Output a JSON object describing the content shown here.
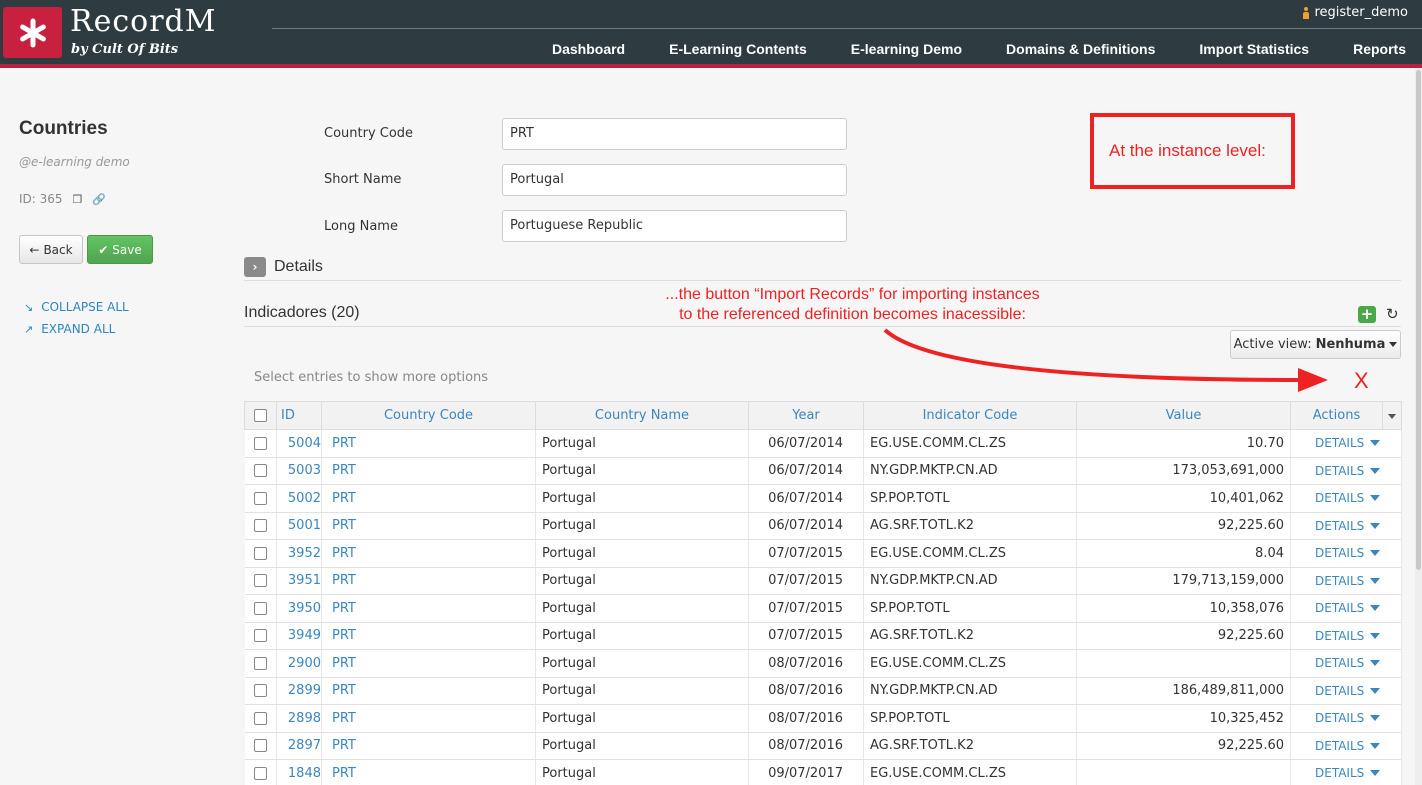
{
  "app": {
    "title": "RecordM",
    "subtitle": "by Cult Of Bits",
    "user": "register_demo"
  },
  "nav": [
    "Dashboard",
    "E-Learning Contents",
    "E-learning Demo",
    "Domains & Definitions",
    "Import Statistics",
    "Reports"
  ],
  "sidebar": {
    "title": "Countries",
    "subtitle": "@e-learning demo",
    "id_label": "ID: 365",
    "back_label": "Back",
    "save_label": "Save",
    "collapse_label": "COLLAPSE ALL",
    "expand_label": "EXPAND ALL"
  },
  "form": {
    "fields": [
      {
        "label": "Country Code",
        "value": "PRT"
      },
      {
        "label": "Short Name",
        "value": "Portugal"
      },
      {
        "label": "Long Name",
        "value": "Portuguese Republic"
      }
    ],
    "details_label": "Details"
  },
  "annotations": {
    "box_text": "At the instance level:",
    "message_line1": "...the button “Import Records” for importing instances",
    "message_line2": "to the referenced definition becomes inacessible:",
    "x_mark": "X"
  },
  "indicators": {
    "title": "Indicadores (20)",
    "active_view_label": "Active view:",
    "active_view_value": "Nenhuma",
    "select_hint": "Select entries to show more options",
    "columns": [
      "ID",
      "Country Code",
      "Country Name",
      "Year",
      "Indicator Code",
      "Value",
      "Actions"
    ],
    "action_label": "DETAILS",
    "rows": [
      {
        "id": "5004",
        "code": "PRT",
        "name": "Portugal",
        "year": "06/07/2014",
        "indicator": "EG.USE.COMM.CL.ZS",
        "value": "10.70"
      },
      {
        "id": "5003",
        "code": "PRT",
        "name": "Portugal",
        "year": "06/07/2014",
        "indicator": "NY.GDP.MKTP.CN.AD",
        "value": "173,053,691,000"
      },
      {
        "id": "5002",
        "code": "PRT",
        "name": "Portugal",
        "year": "06/07/2014",
        "indicator": "SP.POP.TOTL",
        "value": "10,401,062"
      },
      {
        "id": "5001",
        "code": "PRT",
        "name": "Portugal",
        "year": "06/07/2014",
        "indicator": "AG.SRF.TOTL.K2",
        "value": "92,225.60"
      },
      {
        "id": "3952",
        "code": "PRT",
        "name": "Portugal",
        "year": "07/07/2015",
        "indicator": "EG.USE.COMM.CL.ZS",
        "value": "8.04"
      },
      {
        "id": "3951",
        "code": "PRT",
        "name": "Portugal",
        "year": "07/07/2015",
        "indicator": "NY.GDP.MKTP.CN.AD",
        "value": "179,713,159,000"
      },
      {
        "id": "3950",
        "code": "PRT",
        "name": "Portugal",
        "year": "07/07/2015",
        "indicator": "SP.POP.TOTL",
        "value": "10,358,076"
      },
      {
        "id": "3949",
        "code": "PRT",
        "name": "Portugal",
        "year": "07/07/2015",
        "indicator": "AG.SRF.TOTL.K2",
        "value": "92,225.60"
      },
      {
        "id": "2900",
        "code": "PRT",
        "name": "Portugal",
        "year": "08/07/2016",
        "indicator": "EG.USE.COMM.CL.ZS",
        "value": ""
      },
      {
        "id": "2899",
        "code": "PRT",
        "name": "Portugal",
        "year": "08/07/2016",
        "indicator": "NY.GDP.MKTP.CN.AD",
        "value": "186,489,811,000"
      },
      {
        "id": "2898",
        "code": "PRT",
        "name": "Portugal",
        "year": "08/07/2016",
        "indicator": "SP.POP.TOTL",
        "value": "10,325,452"
      },
      {
        "id": "2897",
        "code": "PRT",
        "name": "Portugal",
        "year": "08/07/2016",
        "indicator": "AG.SRF.TOTL.K2",
        "value": "92,225.60"
      },
      {
        "id": "1848",
        "code": "PRT",
        "name": "Portugal",
        "year": "09/07/2017",
        "indicator": "EG.USE.COMM.CL.ZS",
        "value": ""
      }
    ]
  },
  "colors": {
    "header": "#2e3b40",
    "accent": "#c8203f",
    "link": "#3a87c0",
    "annotation": "#ee2222",
    "save": "#5bb75b"
  }
}
